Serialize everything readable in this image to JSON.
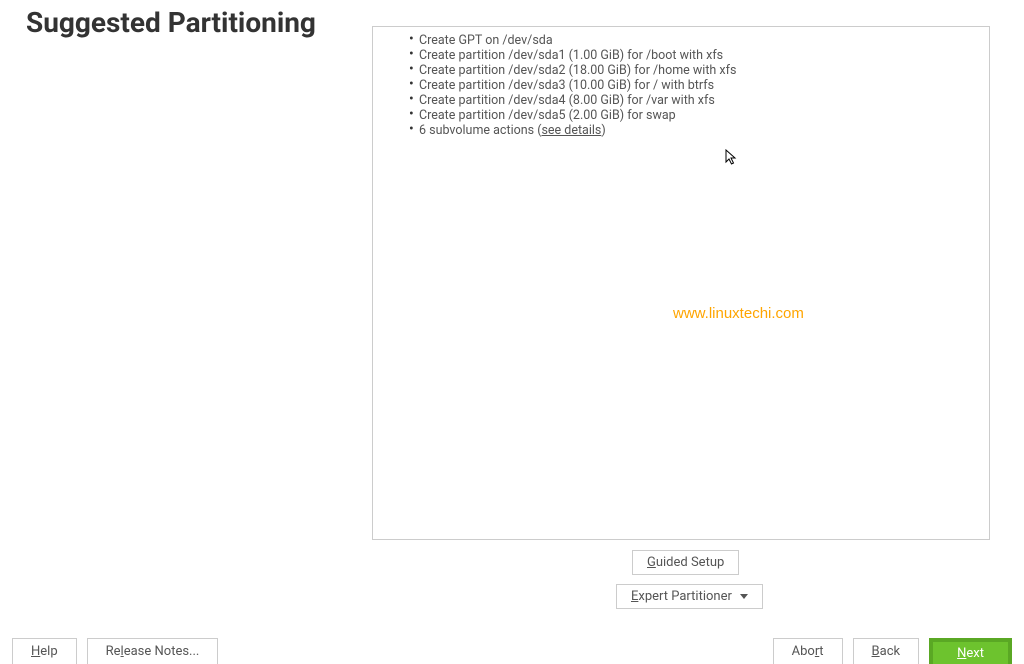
{
  "page": {
    "title": "Suggested Partitioning"
  },
  "partitions": {
    "items": [
      "Create GPT on /dev/sda",
      "Create partition /dev/sda1 (1.00 GiB) for /boot with xfs",
      "Create partition /dev/sda2 (18.00 GiB) for /home with xfs",
      "Create partition /dev/sda3 (10.00 GiB) for / with btrfs",
      "Create partition /dev/sda4 (8.00 GiB) for /var with xfs",
      "Create partition /dev/sda5 (2.00 GiB) for swap"
    ],
    "subvolume_prefix": "6 subvolume actions (",
    "subvolume_link": "see details",
    "subvolume_suffix": ")"
  },
  "watermark": "www.linuxtechi.com",
  "buttons": {
    "guided_setup": {
      "u": "G",
      "rest": "uided Setup"
    },
    "expert_partitioner": {
      "u": "E",
      "rest": "xpert Partitioner"
    },
    "help": {
      "u": "H",
      "rest": "elp"
    },
    "release_notes": {
      "pre": "Re",
      "u": "l",
      "rest": "ease Notes..."
    },
    "abort": {
      "pre": "Abo",
      "u": "r",
      "rest": "t"
    },
    "back": {
      "u": "B",
      "rest": "ack"
    },
    "next": {
      "u": "N",
      "rest": "ext"
    }
  }
}
